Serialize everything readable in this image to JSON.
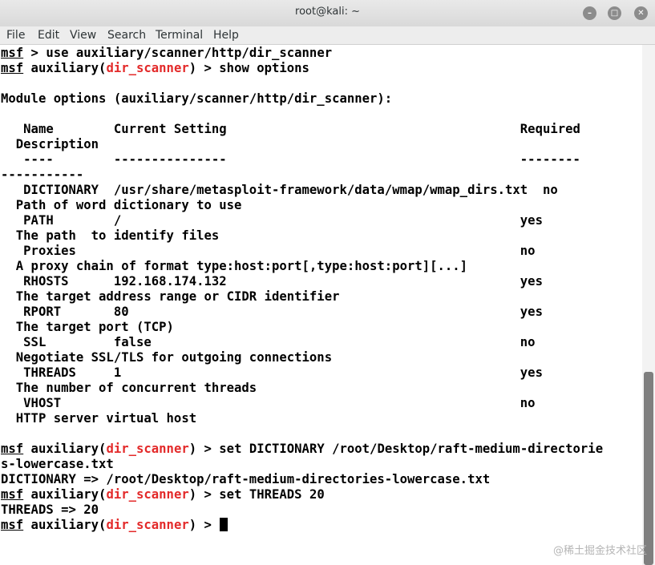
{
  "window": {
    "title": "root@kali: ~",
    "buttons": [
      "minimize",
      "maximize",
      "close"
    ]
  },
  "menu": [
    "File",
    "Edit",
    "View",
    "Search",
    "Terminal",
    "Help"
  ],
  "terminal": {
    "prompt": "msf",
    "module": "dir_scanner",
    "lines": [
      {
        "type": "prompt",
        "cmd": " > use auxiliary/scanner/http/dir_scanner"
      },
      {
        "type": "modprompt",
        "cmd": ") > show options"
      },
      {
        "type": "text",
        "text": ""
      },
      {
        "type": "text",
        "text": "Module options (auxiliary/scanner/http/dir_scanner):"
      },
      {
        "type": "text",
        "text": ""
      },
      {
        "type": "text",
        "text": "   Name        Current Setting                                       Required"
      },
      {
        "type": "text",
        "text": "  Description"
      },
      {
        "type": "text",
        "text": "   ----        ---------------                                       --------"
      },
      {
        "type": "text",
        "text": "-----------"
      },
      {
        "type": "text",
        "text": "   DICTIONARY  /usr/share/metasploit-framework/data/wmap/wmap_dirs.txt  no"
      },
      {
        "type": "text",
        "text": "  Path of word dictionary to use"
      },
      {
        "type": "text",
        "text": "   PATH        /                                                     yes"
      },
      {
        "type": "text",
        "text": "  The path  to identify files"
      },
      {
        "type": "text",
        "text": "   Proxies                                                           no"
      },
      {
        "type": "text",
        "text": "  A proxy chain of format type:host:port[,type:host:port][...]"
      },
      {
        "type": "text",
        "text": "   RHOSTS      192.168.174.132                                       yes"
      },
      {
        "type": "text",
        "text": "  The target address range or CIDR identifier"
      },
      {
        "type": "text",
        "text": "   RPORT       80                                                    yes"
      },
      {
        "type": "text",
        "text": "  The target port (TCP)"
      },
      {
        "type": "text",
        "text": "   SSL         false                                                 no"
      },
      {
        "type": "text",
        "text": "  Negotiate SSL/TLS for outgoing connections"
      },
      {
        "type": "text",
        "text": "   THREADS     1                                                     yes"
      },
      {
        "type": "text",
        "text": "  The number of concurrent threads"
      },
      {
        "type": "text",
        "text": "   VHOST                                                             no"
      },
      {
        "type": "text",
        "text": "  HTTP server virtual host"
      },
      {
        "type": "text",
        "text": ""
      },
      {
        "type": "modprompt",
        "cmd": ") > set DICTIONARY /root/Desktop/raft-medium-directorie"
      },
      {
        "type": "text",
        "text": "s-lowercase.txt"
      },
      {
        "type": "text",
        "text": "DICTIONARY => /root/Desktop/raft-medium-directories-lowercase.txt"
      },
      {
        "type": "modprompt",
        "cmd": ") > set THREADS 20"
      },
      {
        "type": "text",
        "text": "THREADS => 20"
      },
      {
        "type": "modprompt",
        "cmd": ") > ",
        "cursor": true
      }
    ]
  },
  "watermark": "@稀土掘金技术社区"
}
